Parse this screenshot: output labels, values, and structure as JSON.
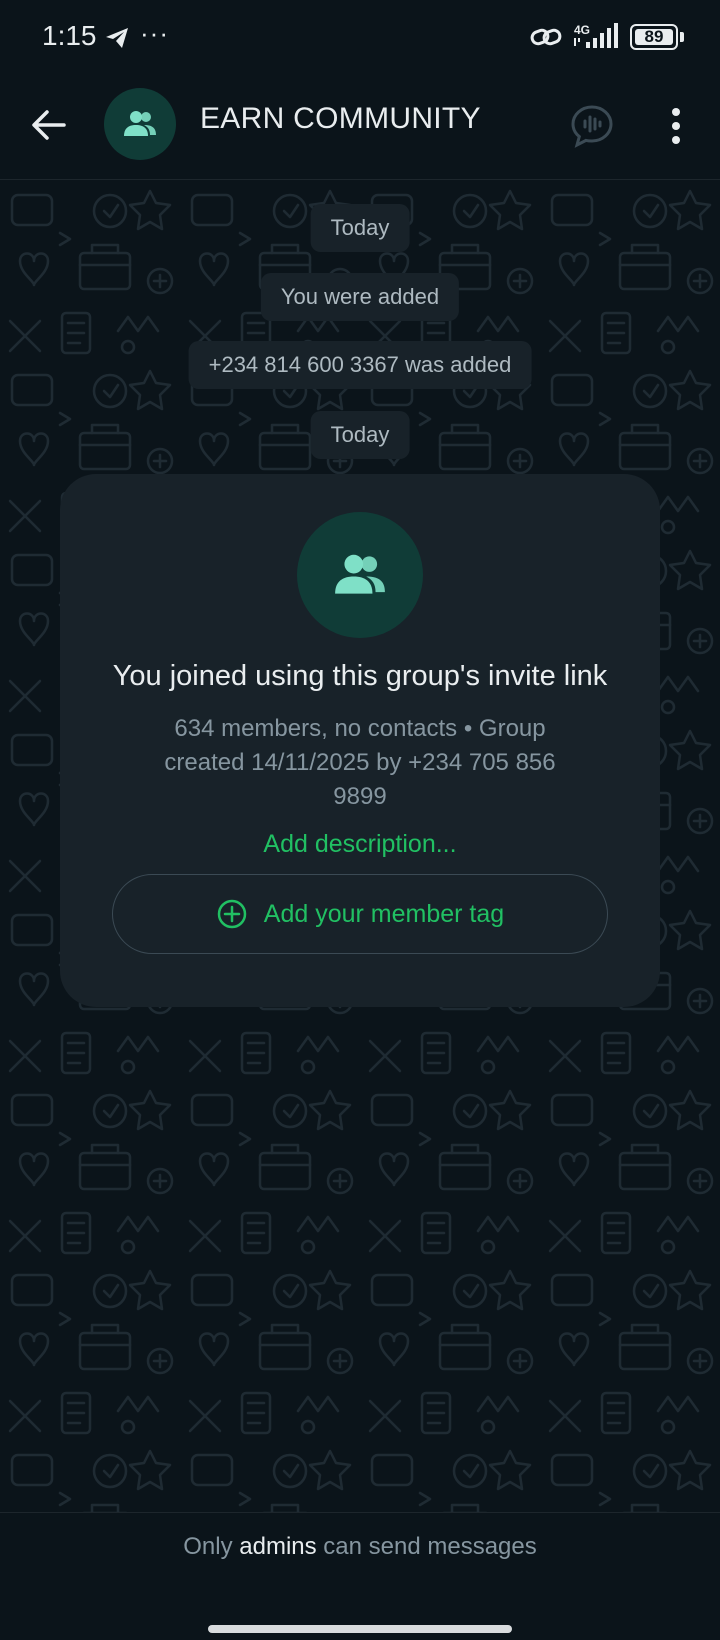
{
  "status_bar": {
    "time": "1:15",
    "dots": "···",
    "network": "4G",
    "battery": "89"
  },
  "header": {
    "group_name": "EARN COMMUNITY"
  },
  "messages": {
    "date_1": "Today",
    "system_1": "You were added",
    "system_2": "+234 814 600 3367 was added",
    "date_2": "Today"
  },
  "info_card": {
    "title": "You joined using this group's invite link",
    "meta": "634 members, no contacts  •  Group created 14/11/2025 by +234 705 856 9899",
    "add_description": "Add description...",
    "member_tag_button": "Add your member tag"
  },
  "footer": {
    "prefix": "Only",
    "highlight": "admins",
    "suffix": "can send messages"
  },
  "colors": {
    "background": "#0b141a",
    "bubble": "#182229",
    "accent_green": "#21c063",
    "avatar_bg": "#103c37",
    "avatar_icon": "#7fe0c7"
  }
}
